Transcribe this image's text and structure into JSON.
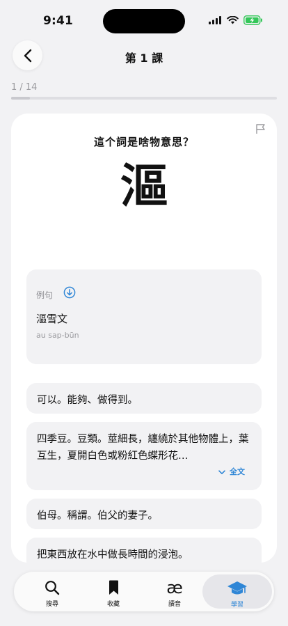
{
  "status_bar": {
    "time": "9:41"
  },
  "header": {
    "title": "第 1 課"
  },
  "progress": {
    "label": "1 / 14",
    "fraction": 0.0714
  },
  "card": {
    "question": "這个詞是啥物意思？",
    "word": "漚",
    "example": {
      "label": "例句",
      "text": "漚雪文",
      "romanization": "au sap-būn"
    },
    "options": [
      {
        "text": "可以。能夠、做得到。"
      },
      {
        "text": "四季豆。豆類。莖細長，纏繞於其他物體上，葉互生，夏開白色或粉紅色蝶形花…",
        "expand_label": "全文"
      },
      {
        "text": "伯母。稱謂。伯父的妻子。"
      },
      {
        "text": "把東西放在水中做長時間的浸泡。"
      }
    ]
  },
  "tabbar": {
    "tabs": [
      {
        "label": "搜尋",
        "icon": "search-icon"
      },
      {
        "label": "收藏",
        "icon": "bookmark-icon"
      },
      {
        "label": "讀音",
        "icon": "ae-icon"
      },
      {
        "label": "學習",
        "icon": "graduation-cap-icon",
        "active": true
      }
    ]
  },
  "colors": {
    "accent": "#2f86d6",
    "battery": "#34c759"
  }
}
